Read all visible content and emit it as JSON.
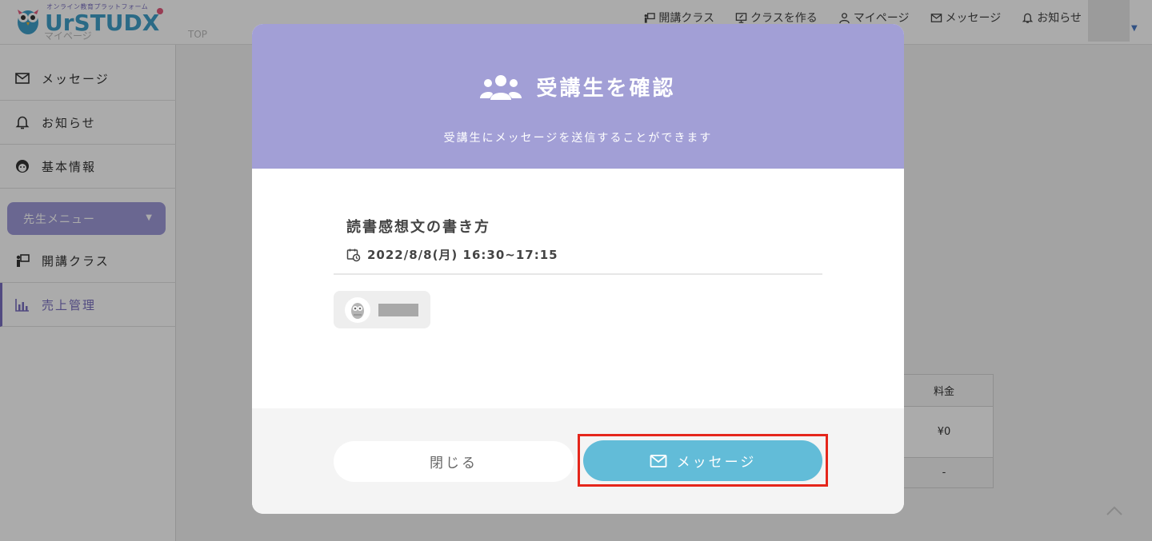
{
  "header": {
    "logo_tagline": "オンライン教育プラットフォーム",
    "logo_text": "UrSTUDX",
    "breadcrumb_page": "マイページ",
    "breadcrumb_top": "TOP",
    "nav": [
      {
        "label": "開講クラス",
        "icon": "classroom-icon"
      },
      {
        "label": "クラスを作る",
        "icon": "create-class-icon"
      },
      {
        "label": "マイページ",
        "icon": "user-icon"
      },
      {
        "label": "メッセージ",
        "icon": "mail-icon"
      },
      {
        "label": "お知らせ",
        "icon": "bell-icon"
      }
    ]
  },
  "sidebar": {
    "items": [
      {
        "label": "メッセージ",
        "icon": "mail-icon"
      },
      {
        "label": "お知らせ",
        "icon": "bell-icon"
      },
      {
        "label": "基本情報",
        "icon": "face-icon"
      }
    ],
    "teacher_menu_label": "先生メニュー",
    "teacher_items": [
      {
        "label": "開講クラス",
        "icon": "classroom-icon"
      },
      {
        "label": "売上管理",
        "icon": "bar-chart-icon"
      }
    ]
  },
  "background_table": {
    "header": "料金",
    "rows": [
      "¥0",
      "-"
    ]
  },
  "modal": {
    "title": "受講生を確認",
    "subtitle": "受講生にメッセージを送信することができます",
    "class_title": "読書感想文の書き方",
    "class_datetime": "2022/8/8(月) 16:30~17:15",
    "student_name": "",
    "close_label": "閉じる",
    "message_label": "メッセージ"
  },
  "colors": {
    "modal_header": "#a29fd6",
    "message_button": "#62bcd8",
    "highlight_box": "#e5261b",
    "accent_purple": "#7a6fc0"
  }
}
